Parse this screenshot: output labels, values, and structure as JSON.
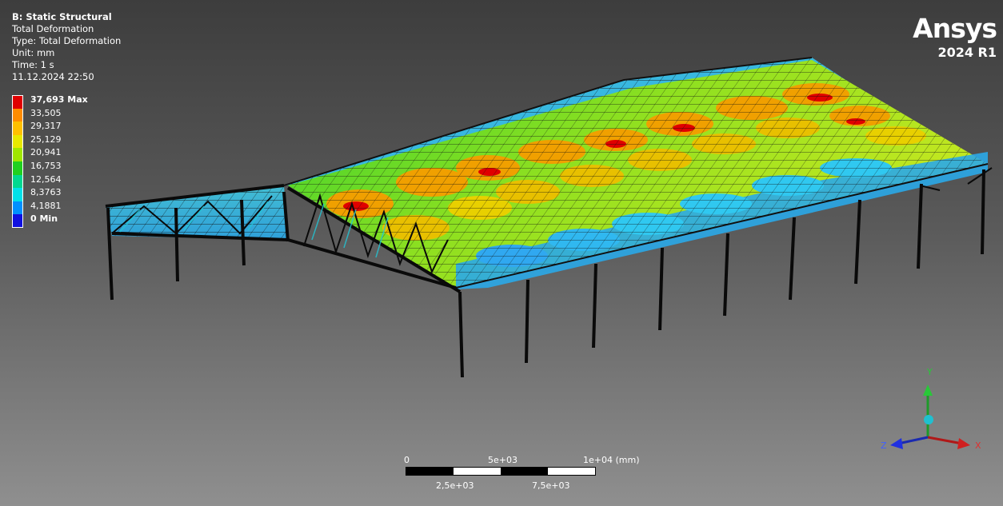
{
  "header": {
    "analysis_title": "B: Static Structural",
    "result_name": "Total Deformation",
    "result_type": "Type: Total Deformation",
    "unit": "Unit: mm",
    "time": "Time: 1 s",
    "timestamp": "11.12.2024 22:50"
  },
  "brand": {
    "name": "Ansys",
    "version": "2024 R1"
  },
  "legend": {
    "entries": [
      {
        "label": "37,693 Max",
        "color": "#e00000",
        "bold": true
      },
      {
        "label": "33,505",
        "color": "#ff8c00",
        "bold": false
      },
      {
        "label": "29,317",
        "color": "#ffc000",
        "bold": false
      },
      {
        "label": "25,129",
        "color": "#e8e800",
        "bold": false
      },
      {
        "label": "20,941",
        "color": "#a0e600",
        "bold": false
      },
      {
        "label": "16,753",
        "color": "#20d020",
        "bold": false
      },
      {
        "label": "12,564",
        "color": "#00d890",
        "bold": false
      },
      {
        "label": "8,3763",
        "color": "#00e0e8",
        "bold": false
      },
      {
        "label": "4,1881",
        "color": "#0090ff",
        "bold": false
      },
      {
        "label": "0 Min",
        "color": "#1010e0",
        "bold": true
      }
    ]
  },
  "scale_bar": {
    "top_labels": [
      "0",
      "5e+03",
      "1e+04 (mm)"
    ],
    "bottom_labels": [
      "2,5e+03",
      "7,5e+03"
    ]
  },
  "triad": {
    "y_label": "Y",
    "z_label": "Z",
    "x_label": "X"
  }
}
